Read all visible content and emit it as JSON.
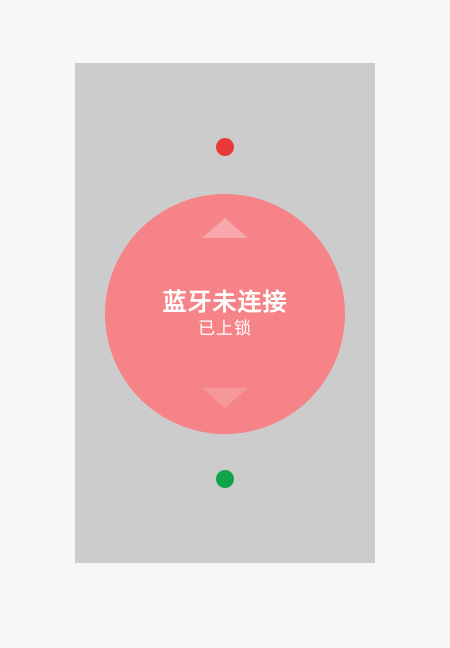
{
  "device": {
    "bluetooth_status": "蓝牙未连接",
    "lock_status": "已上锁"
  },
  "colors": {
    "page_background": "#f7f7f9",
    "panel_background": "#cdcccd",
    "dial": "#f68387",
    "top_indicator": "#e93a3a",
    "bottom_indicator": "#11a34a"
  },
  "icons": {
    "up": "triangle-up-icon",
    "down": "triangle-down-icon",
    "top_status": "red-dot-icon",
    "bottom_status": "green-dot-icon"
  }
}
